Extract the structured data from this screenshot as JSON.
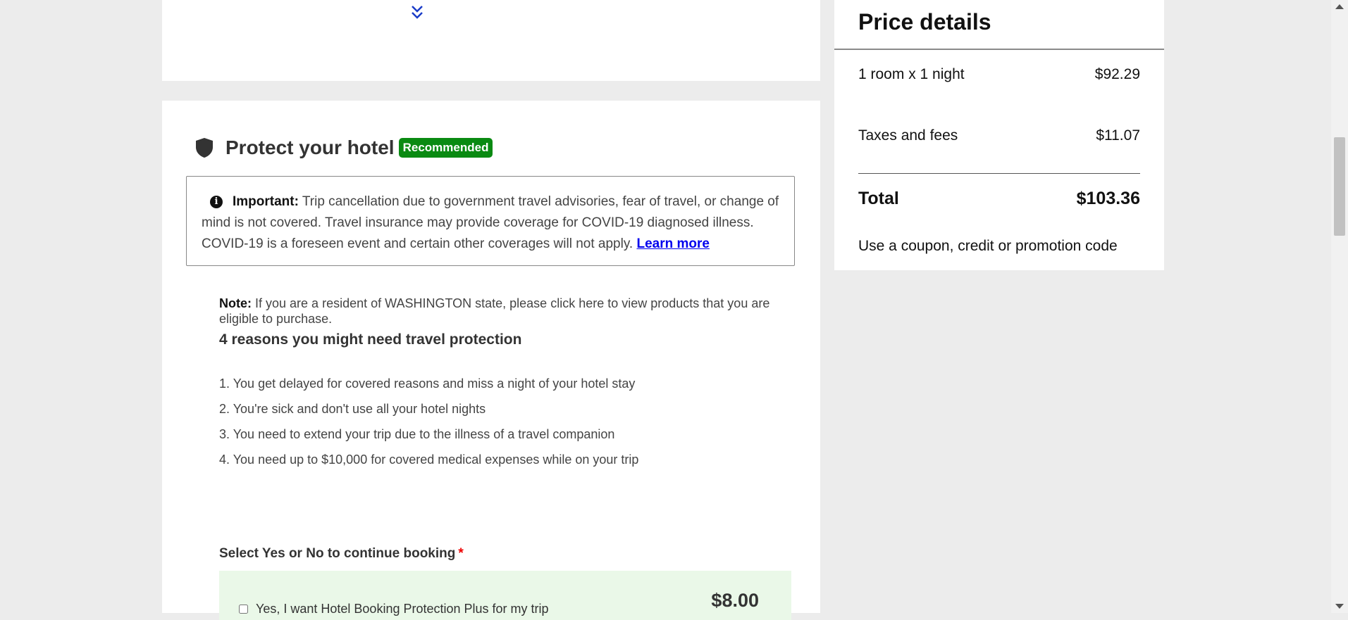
{
  "protect": {
    "title": "Protect your hotel",
    "badge": "Recommended",
    "important_label": "Important:",
    "important_text": "Trip cancellation due to government travel advisories, fear of travel, or change of mind is not covered. Travel insurance may provide coverage for COVID-19 diagnosed illness. COVID-19 is a foreseen event and certain other coverages will not apply.",
    "learn_more": "Learn more",
    "note_label": "Note:",
    "note_text": "If you are a resident of WASHINGTON state, please click here to view products that you are eligible to purchase.",
    "reasons_title": "4 reasons you might need travel protection",
    "reasons": [
      "1. You get delayed for covered reasons and miss a night of your hotel stay",
      "2. You're sick and don't use all your hotel nights",
      "3. You need to extend your trip due to the illness of a travel companion",
      "4. You need up to $10,000 for covered medical expenses while on your trip"
    ],
    "select_label": "Select Yes or No to continue booking",
    "required_mark": "*",
    "option_yes_label": "Yes, I want Hotel Booking Protection Plus for my trip",
    "option_yes_price": "$8.00"
  },
  "price": {
    "title": "Price details",
    "rows": [
      {
        "label": "1 room x 1 night",
        "value": "$92.29"
      },
      {
        "label": "Taxes and fees",
        "value": "$11.07"
      }
    ],
    "total_label": "Total",
    "total_value": "$103.36",
    "coupon": "Use a coupon, credit or promotion code"
  },
  "icons": {
    "expand": "chevron-double-down-icon",
    "shield": "shield-icon",
    "info": "info-icon"
  },
  "colors": {
    "badge": "#0a8a12",
    "link": "#0000ee",
    "option_bg": "#eaf8e8",
    "expand_icon": "#1a3cc8"
  }
}
